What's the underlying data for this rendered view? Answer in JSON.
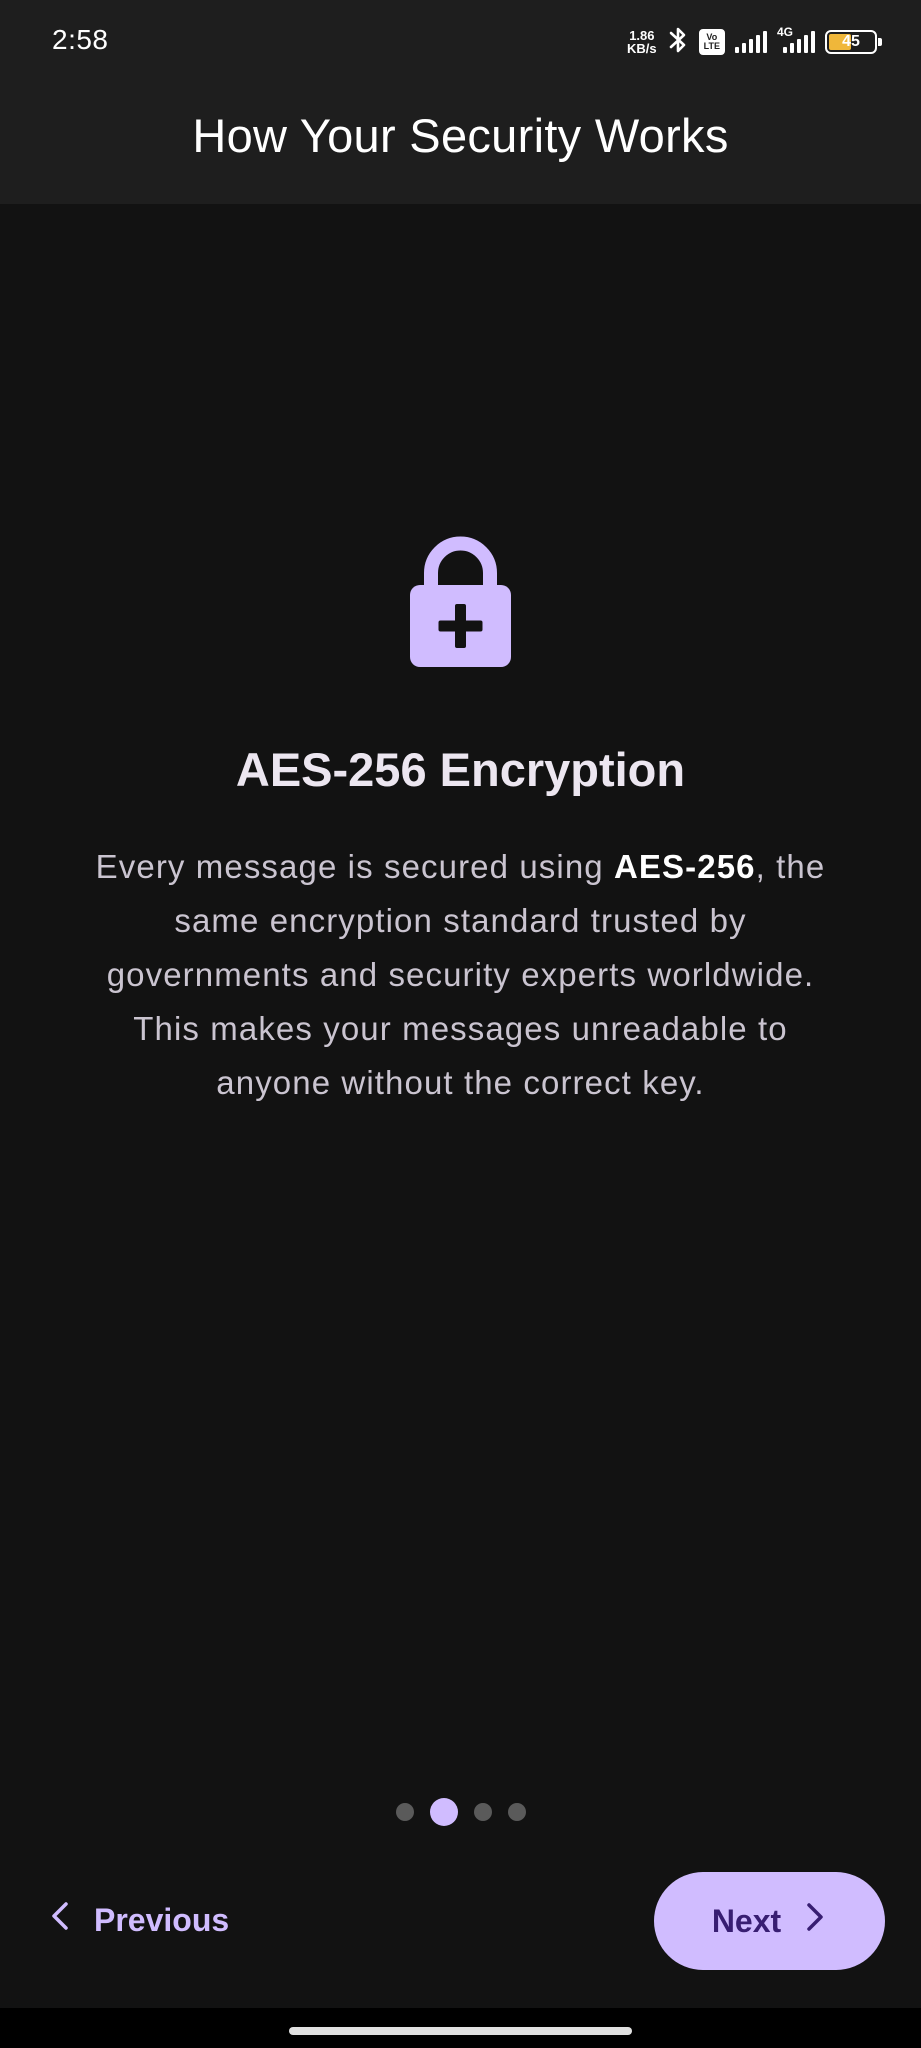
{
  "status_bar": {
    "time": "2:58",
    "net_speed_value": "1.86",
    "net_speed_unit": "KB/s",
    "volte_top": "Vo",
    "volte_bottom": "LTE",
    "network_type": "4G",
    "battery_level": "45",
    "icons": [
      "bluetooth-icon",
      "volte-icon",
      "signal-icon",
      "signal-4g-icon",
      "battery-icon"
    ]
  },
  "header": {
    "title": "How Your Security Works"
  },
  "slide": {
    "icon": "lock-plus-icon",
    "title": "AES-256 Encryption",
    "description_before": "Every message is secured using ",
    "description_bold": "AES-256",
    "description_after": ", the same encryption standard trusted by governments and security experts worldwide. This makes your messages unreadable to anyone without the correct key."
  },
  "pagination": {
    "total": 4,
    "current": 2
  },
  "footer": {
    "previous_label": "Previous",
    "next_label": "Next"
  },
  "colors": {
    "accent": "#d0bcff",
    "on_accent": "#381e72",
    "background": "#121212",
    "app_bar": "#1e1e1e"
  }
}
